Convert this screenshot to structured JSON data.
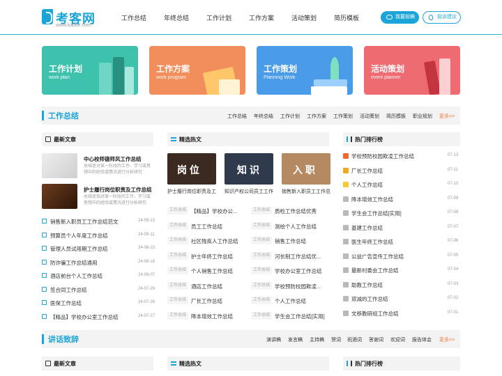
{
  "header": {
    "logo_text": "考客网",
    "logo_url": "www.kaoke.com",
    "nav": [
      "工作总结",
      "年终总结",
      "工作计划",
      "工作方案",
      "活动策划",
      "简历模板"
    ],
    "contribute_label": "我要投稿",
    "suggest_label": "投诉建议"
  },
  "cards": [
    {
      "title": "工作计划",
      "subtitle": "work plan",
      "color": "#3fc2ad"
    },
    {
      "title": "工作方案",
      "subtitle": "work program",
      "color": "#f28e5b"
    },
    {
      "title": "工作策划",
      "subtitle": "Planning Work",
      "color": "#4a9be8"
    },
    {
      "title": "活动策划",
      "subtitle": "event planner",
      "color": "#ef6b72"
    }
  ],
  "section1": {
    "title": "工作总结",
    "links": [
      "工作总结",
      "年终总结",
      "工作计划",
      "工作方案",
      "工作策划",
      "活动策划",
      "简历模板",
      "职业规划"
    ],
    "more": "更多>>"
  },
  "latest": {
    "header": "最新文章",
    "featured": [
      {
        "title": "中心校师德师风工作总结",
        "desc": "总结是对某一阶段的工作、学习或思想中的经验或情况进行分析研究"
      },
      {
        "title": "护士履行岗位职责及工作总结",
        "desc": "总结是指对某一阶段的工作、学习或思想中的经验或情况进行分析研究"
      }
    ],
    "list": [
      {
        "text": "销售新入职员工工作总结范文",
        "date": "24-09-13"
      },
      {
        "text": "预算员个人年度工作总结",
        "date": "24-09-11"
      },
      {
        "text": "管理人员试用期工作总结",
        "date": "24-08-23"
      },
      {
        "text": "防诈骗工作总结通用",
        "date": "24-08-18"
      },
      {
        "text": "酒店前台个人工作总结",
        "date": "24-08-07"
      },
      {
        "text": "签合同工作总结",
        "date": "24-07-29"
      },
      {
        "text": "医保工作总结",
        "date": "24-07-28"
      },
      {
        "text": "【精品】学校办公室工作总结",
        "date": "24-07-27"
      }
    ]
  },
  "hot": {
    "header": "精选热文",
    "pics": [
      {
        "label": "岗 位",
        "caption": "护士履行岗位职责及工"
      },
      {
        "label": "知 识",
        "caption": "知识产权公司员工工作"
      },
      {
        "label": "入 职",
        "caption": "销售新入职员工工作总"
      }
    ],
    "tag": "工作总结",
    "left": [
      "【精品】学校办公...",
      "员工工作总结",
      "社区残疾人工作总结",
      "护士年终工作总结",
      "个人销售工作总结",
      "酒店工作总结",
      "厂长工作总结",
      "降本增效工作总结"
    ],
    "right": [
      "质检工作总结优秀",
      "测绘个人工作总结",
      "销售工作总结",
      "河长制工作总结优...",
      "学校办公室工作总结",
      "学校预防校园欺凌...",
      "个人工作总结",
      "学生会工作总结[实用]"
    ]
  },
  "ranking": {
    "header": "热门排行榜",
    "items": [
      {
        "text": "学校预防校园欺凌工作总结",
        "date": "07-13"
      },
      {
        "text": "厂长工作总结",
        "date": "07-11"
      },
      {
        "text": "个人工作总结",
        "date": "07-10"
      },
      {
        "text": "降本增效工作总结",
        "date": "07-09"
      },
      {
        "text": "学生会工作总结[实用]",
        "date": "07-08"
      },
      {
        "text": "基建工作总结",
        "date": "07-07"
      },
      {
        "text": "医生年终工作总结",
        "date": "07-06"
      },
      {
        "text": "公益广告宣传工作总结",
        "date": "07-05"
      },
      {
        "text": "最新村委会工作总结",
        "date": "07-04"
      },
      {
        "text": "助教工作总结",
        "date": "07-03"
      },
      {
        "text": "双减的工作总结",
        "date": "07-02"
      },
      {
        "text": "文移教研组工作总结",
        "date": "07-01"
      }
    ],
    "rank_colors": [
      "#f5662f",
      "#f5a623",
      "#f7c935",
      "#b9b9b9"
    ]
  },
  "section2": {
    "title": "讲话致辞",
    "links": [
      "演讲稿",
      "发言稿",
      "主持稿",
      "贺词",
      "祝酒词",
      "答谢词",
      "欢迎词",
      "报告体会"
    ],
    "more": "更多>>",
    "col_headers": [
      "最新文章",
      "精选热文",
      "热门排行榜"
    ]
  }
}
